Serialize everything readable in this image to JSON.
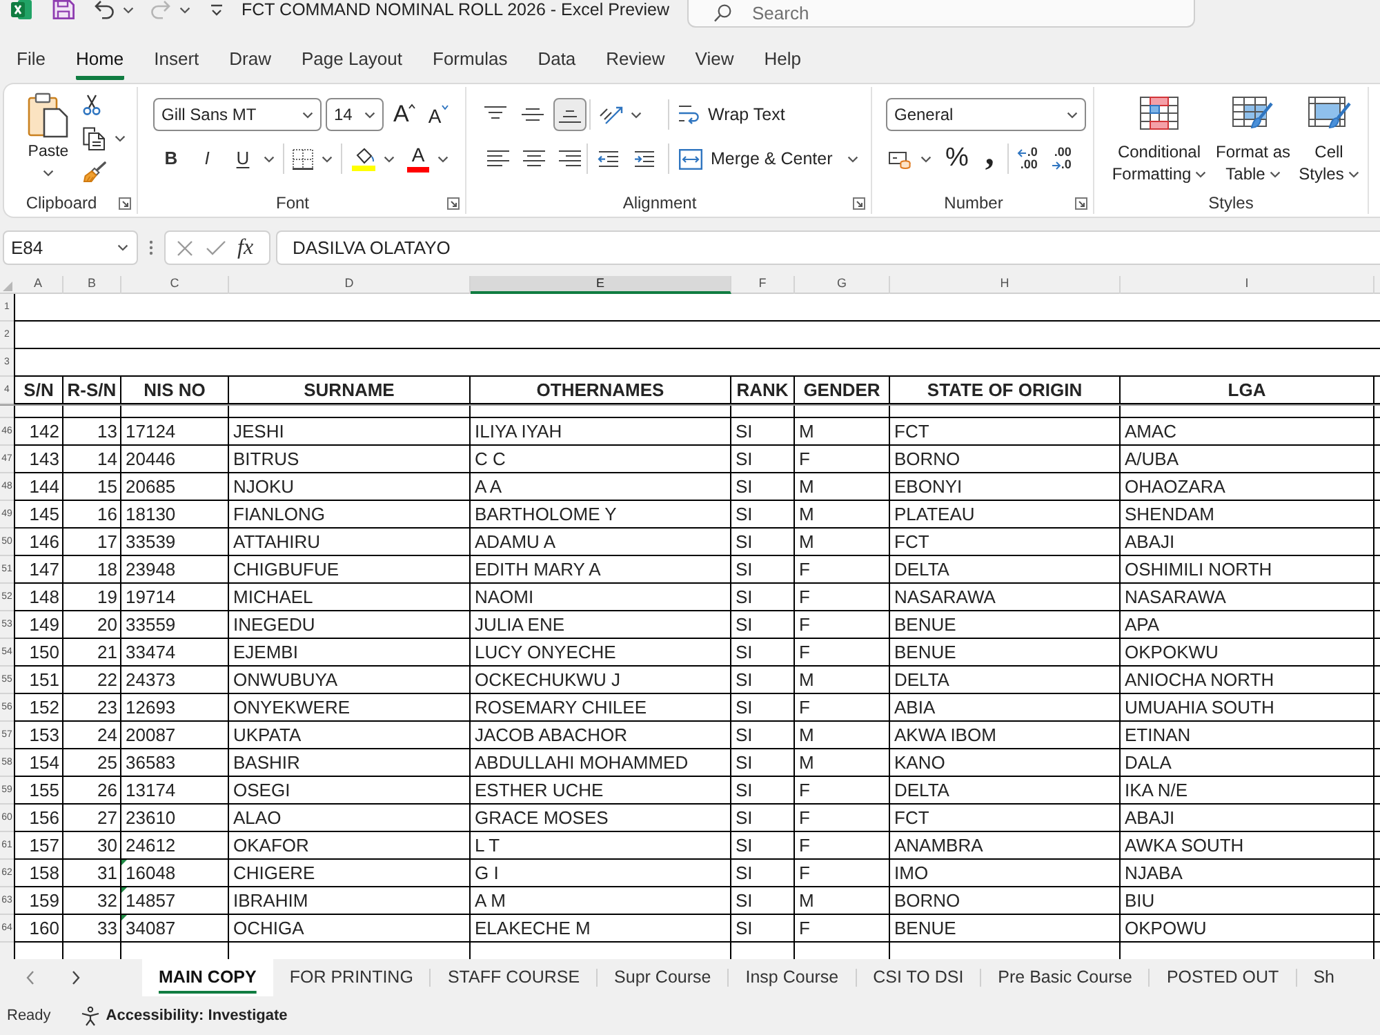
{
  "title_bar": {
    "quick_access": [
      {
        "kind": "save",
        "disabled": false
      },
      {
        "kind": "undo",
        "disabled": false
      },
      {
        "kind": "redo",
        "disabled": true
      },
      {
        "kind": "customize",
        "disabled": false
      }
    ],
    "title": "FCT COMMAND NOMINAL ROLL 2026 - Excel Preview",
    "search": {
      "placeholder": "Search"
    }
  },
  "menu_tabs": [
    {
      "label": "File",
      "selected": false
    },
    {
      "label": "Home",
      "selected": true
    },
    {
      "label": "Insert",
      "selected": false
    },
    {
      "label": "Draw",
      "selected": false
    },
    {
      "label": "Page Layout",
      "selected": false
    },
    {
      "label": "Formulas",
      "selected": false
    },
    {
      "label": "Data",
      "selected": false
    },
    {
      "label": "Review",
      "selected": false
    },
    {
      "label": "View",
      "selected": false
    },
    {
      "label": "Help",
      "selected": false
    }
  ],
  "ribbon": {
    "clipboard": {
      "label": "Clipboard",
      "paste": "Paste"
    },
    "font": {
      "label": "Font",
      "font_name": "Gill Sans MT",
      "font_size": "14",
      "size_buttons": [
        {
          "kind": "grow",
          "glyph": "A"
        },
        {
          "kind": "shrink",
          "glyph": "A"
        }
      ],
      "style_buttons": [
        {
          "kind": "bold",
          "glyph": "B"
        },
        {
          "kind": "italic",
          "glyph": "I"
        },
        {
          "kind": "underline",
          "glyph": "U"
        }
      ],
      "font_color_glyph": "A"
    },
    "alignment": {
      "label": "Alignment",
      "vertical": [
        {
          "kind": "top",
          "selected": false
        },
        {
          "kind": "middle",
          "selected": false
        },
        {
          "kind": "bottom",
          "selected": true
        }
      ],
      "wrap_text": "Wrap Text",
      "merge_center": "Merge & Center"
    },
    "number": {
      "label": "Number",
      "format": "General",
      "percent": "%",
      "comma": ",",
      "decimals": [
        {
          "kind": "increase",
          "lines": [
            ".0",
            ".00"
          ]
        },
        {
          "kind": "decrease",
          "lines": [
            ".00",
            ".0"
          ]
        }
      ]
    },
    "styles": {
      "label": "Styles",
      "buttons": [
        {
          "kind": "conditional",
          "label": "Conditional Formatting"
        },
        {
          "kind": "table",
          "label": "Format as Table"
        },
        {
          "kind": "cell",
          "label": "Cell Styles"
        }
      ]
    }
  },
  "formula_bar": {
    "name_box": "E84",
    "function_glyph": "fx",
    "content": "DASILVA OLATAYO"
  },
  "sheet": {
    "column_letters": [
      {
        "letter": "A",
        "selected": false
      },
      {
        "letter": "B",
        "selected": false
      },
      {
        "letter": "C",
        "selected": false
      },
      {
        "letter": "D",
        "selected": false
      },
      {
        "letter": "E",
        "selected": true
      },
      {
        "letter": "F",
        "selected": false
      },
      {
        "letter": "G",
        "selected": false
      },
      {
        "letter": "H",
        "selected": false
      },
      {
        "letter": "I",
        "selected": false
      }
    ],
    "title_rows": [
      "1",
      "2",
      "3"
    ],
    "header": {
      "row_number": "4",
      "cells": [
        "S/N",
        "R-S/N",
        "NIS NO",
        "SURNAME",
        "OTHERNAMES",
        "RANK",
        "GENDER",
        "STATE OF ORIGIN",
        "LGA"
      ]
    },
    "rows": [
      {
        "row_number": "46",
        "cells": [
          "142",
          "13",
          "17124",
          "JESHI",
          "ILIYA IYAH",
          "SI",
          "M",
          "FCT",
          "AMAC"
        ],
        "number_as_text": false
      },
      {
        "row_number": "47",
        "cells": [
          "143",
          "14",
          "20446",
          "BITRUS",
          "C C",
          "SI",
          "F",
          "BORNO",
          "A/UBA"
        ],
        "number_as_text": false
      },
      {
        "row_number": "48",
        "cells": [
          "144",
          "15",
          "20685",
          "NJOKU",
          "A A",
          "SI",
          "M",
          "EBONYI",
          "OHAOZARA"
        ],
        "number_as_text": false
      },
      {
        "row_number": "49",
        "cells": [
          "145",
          "16",
          "18130",
          "FIANLONG",
          "BARTHOLOME Y",
          "SI",
          "M",
          "PLATEAU",
          "SHENDAM"
        ],
        "number_as_text": false
      },
      {
        "row_number": "50",
        "cells": [
          "146",
          "17",
          "33539",
          "ATTAHIRU",
          "ADAMU A",
          "SI",
          "M",
          "FCT",
          "ABAJI"
        ],
        "number_as_text": false
      },
      {
        "row_number": "51",
        "cells": [
          "147",
          "18",
          "23948",
          "CHIGBUFUE",
          "EDITH MARY A",
          "SI",
          "F",
          "DELTA",
          "OSHIMILI NORTH"
        ],
        "number_as_text": false
      },
      {
        "row_number": "52",
        "cells": [
          "148",
          "19",
          "19714",
          "MICHAEL",
          "NAOMI",
          "SI",
          "F",
          "NASARAWA",
          "NASARAWA"
        ],
        "number_as_text": false
      },
      {
        "row_number": "53",
        "cells": [
          "149",
          "20",
          "33559",
          "INEGEDU",
          "JULIA ENE",
          "SI",
          "F",
          "BENUE",
          "APA"
        ],
        "number_as_text": false
      },
      {
        "row_number": "54",
        "cells": [
          "150",
          "21",
          "33474",
          "EJEMBI",
          "LUCY ONYECHE",
          "SI",
          "F",
          "BENUE",
          "OKPOKWU"
        ],
        "number_as_text": false
      },
      {
        "row_number": "55",
        "cells": [
          "151",
          "22",
          "24373",
          "ONWUBUYA",
          "OCKECHUKWU J",
          "SI",
          "M",
          "DELTA",
          "ANIOCHA NORTH"
        ],
        "number_as_text": false
      },
      {
        "row_number": "56",
        "cells": [
          "152",
          "23",
          "12693",
          "ONYEKWERE",
          "ROSEMARY CHILEE",
          "SI",
          "F",
          "ABIA",
          "UMUAHIA SOUTH"
        ],
        "number_as_text": false
      },
      {
        "row_number": "57",
        "cells": [
          "153",
          "24",
          "20087",
          "UKPATA",
          "JACOB ABACHOR",
          "SI",
          "M",
          "AKWA IBOM",
          "ETINAN"
        ],
        "number_as_text": false
      },
      {
        "row_number": "58",
        "cells": [
          "154",
          "25",
          "36583",
          "BASHIR",
          "ABDULLAHI MOHAMMED",
          "SI",
          "M",
          "KANO",
          "DALA"
        ],
        "number_as_text": false
      },
      {
        "row_number": "59",
        "cells": [
          "155",
          "26",
          "13174",
          "OSEGI",
          "ESTHER UCHE",
          "SI",
          "F",
          "DELTA",
          "IKA N/E"
        ],
        "number_as_text": false
      },
      {
        "row_number": "60",
        "cells": [
          "156",
          "27",
          "23610",
          "ALAO",
          "GRACE MOSES",
          "SI",
          "F",
          "FCT",
          "ABAJI"
        ],
        "number_as_text": false
      },
      {
        "row_number": "61",
        "cells": [
          "157",
          "30",
          "24612",
          "OKAFOR",
          "L T",
          "SI",
          "F",
          "ANAMBRA",
          "AWKA SOUTH"
        ],
        "number_as_text": false
      },
      {
        "row_number": "62",
        "cells": [
          "158",
          "31",
          "16048",
          "CHIGERE",
          "G I",
          "SI",
          "F",
          "IMO",
          "NJABA"
        ],
        "number_as_text": true
      },
      {
        "row_number": "63",
        "cells": [
          "159",
          "32",
          "14857",
          "IBRAHIM",
          "A M",
          "SI",
          "M",
          "BORNO",
          "BIU"
        ],
        "number_as_text": true
      },
      {
        "row_number": "64",
        "cells": [
          "160",
          "33",
          "34087",
          "OCHIGA",
          "ELAKECHE M",
          "SI",
          "F",
          "BENUE",
          "OKPOWU"
        ],
        "number_as_text": true
      }
    ]
  },
  "sheet_tabs": [
    {
      "label": "MAIN COPY",
      "selected": true
    },
    {
      "label": "FOR PRINTING",
      "selected": false
    },
    {
      "label": "STAFF COURSE",
      "selected": false
    },
    {
      "label": "Supr Course",
      "selected": false
    },
    {
      "label": "Insp Course",
      "selected": false
    },
    {
      "label": "CSI TO DSI",
      "selected": false
    },
    {
      "label": "Pre Basic Course",
      "selected": false
    },
    {
      "label": "POSTED OUT",
      "selected": false
    },
    {
      "label": "Sh",
      "selected": false
    }
  ],
  "status_bar": {
    "mode": "Ready",
    "accessibility": "Accessibility: Investigate"
  }
}
